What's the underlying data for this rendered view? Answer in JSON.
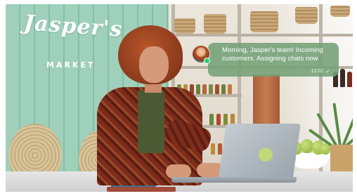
{
  "scene": {
    "sign": {
      "title": "Jasper's",
      "subtitle": "MARKET"
    }
  },
  "notification": {
    "message": "Morning, Jasper's team! Incoming customers. Assigning chats now",
    "time": "12:02",
    "status_icon": "double-check-icon",
    "online_color": "#25d366",
    "bubble_color": "#74a076"
  }
}
